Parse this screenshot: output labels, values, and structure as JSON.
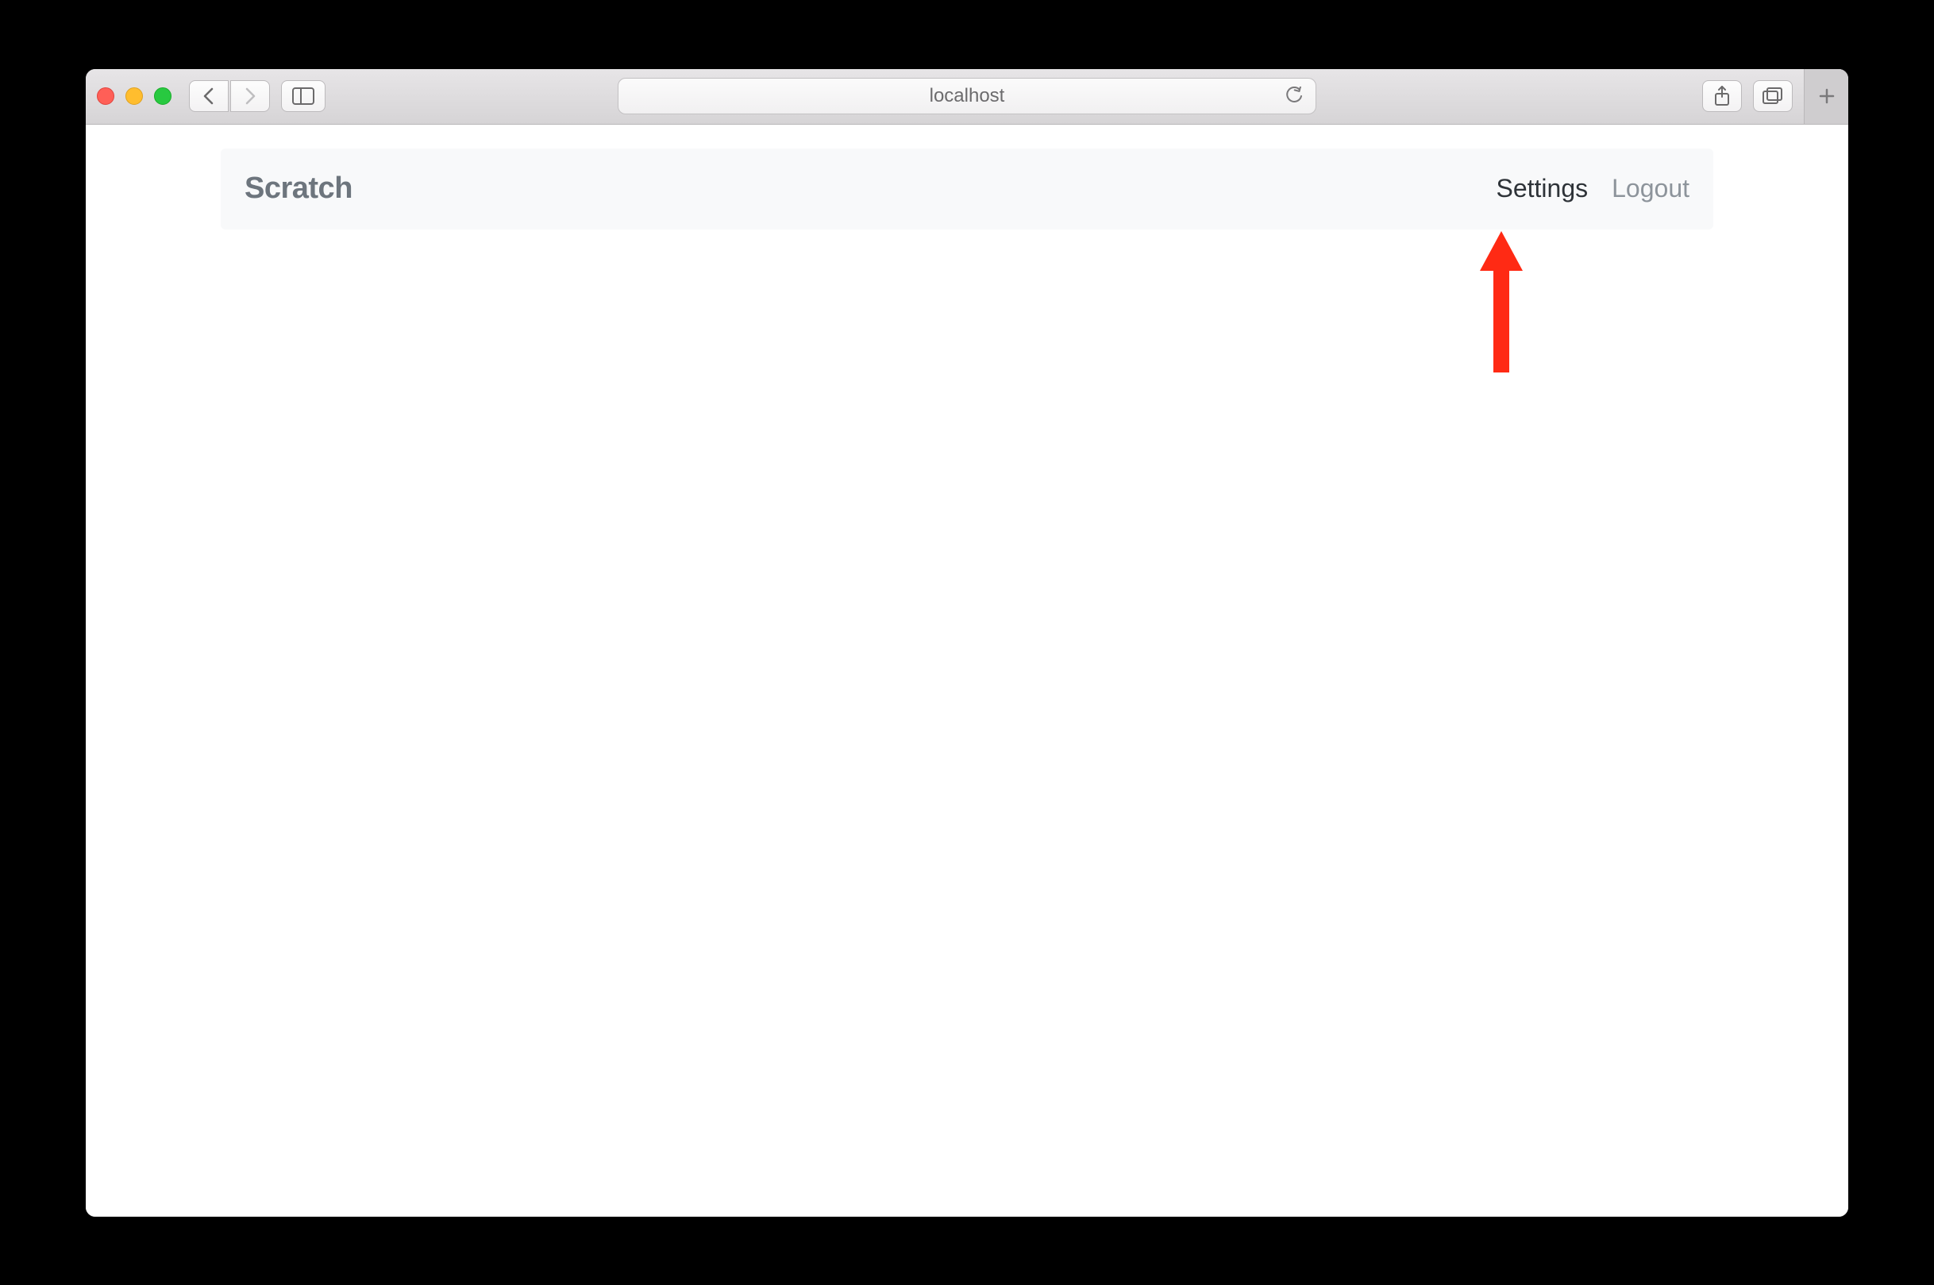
{
  "browser": {
    "address": "localhost"
  },
  "navbar": {
    "brand": "Scratch",
    "links": {
      "settings": "Settings",
      "logout": "Logout"
    }
  }
}
